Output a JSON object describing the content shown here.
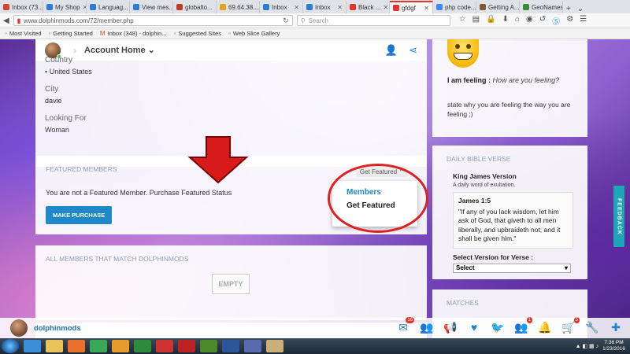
{
  "browser": {
    "tabs": [
      {
        "label": "Inbox (73...",
        "color": "#d44638"
      },
      {
        "label": "My Shop",
        "color": "#2e7bd6"
      },
      {
        "label": "Languag...",
        "color": "#2e7bd6"
      },
      {
        "label": "View mes...",
        "color": "#2e7bd6"
      },
      {
        "label": "globalto...",
        "color": "#c0392b"
      },
      {
        "label": "69.64.38....",
        "color": "#e8a317"
      },
      {
        "label": "Inbox",
        "color": "#2e7bd6"
      },
      {
        "label": "Inbox",
        "color": "#2e7bd6"
      },
      {
        "label": "Black ...",
        "color": "#e3352b"
      },
      {
        "label": "gfdgf",
        "color": "#e3352b"
      },
      {
        "label": "php code...",
        "color": "#4285f4"
      },
      {
        "label": "Getting A...",
        "color": "#7a5a3a"
      },
      {
        "label": "GeoNames",
        "color": "#3a8a3a"
      }
    ],
    "url": "www.dolphinmods.com/72/member.php",
    "search_placeholder": "Search",
    "bookmarks": [
      "Most Visited",
      "Getting Started",
      "Inbox (348) - dolphin...",
      "Suggested Sites",
      "Web Slice Gallery"
    ]
  },
  "header": {
    "title": "Account Home"
  },
  "profile": {
    "country_label": "Country",
    "country_value": "United States",
    "city_label": "City",
    "city_value": "davie",
    "looking_label": "Looking For",
    "looking_value": "Woman"
  },
  "featured": {
    "heading": "FEATURED MEMBERS",
    "toggle_label": "Get Featured",
    "message": "You are not a Featured Member. Purchase Featured Status",
    "button": "MAKE PURCHASE",
    "dropdown": [
      "Members",
      "Get Featured"
    ]
  },
  "all_members": {
    "heading": "ALL MEMBERS THAT MATCH DOLPHINMODS",
    "empty": "EMPTY"
  },
  "mood": {
    "feeling_label": "I am feeling :",
    "feeling_placeholder": "How are you feeling?",
    "state_text": "state why you are feeling the way you are feeling :)"
  },
  "bible": {
    "heading": "DAILY BIBLE VERSE",
    "version": "King James Version",
    "subtitle": "A daily word of exultation.",
    "reference": "James 1:5",
    "verse": "\"If any of you lack wisdom, let him ask of God, that giveth to all men liberally, and upbraideth not; and it shall be given him.\"",
    "select_label": "Select Version for Verse :",
    "select_value": "Select"
  },
  "matches": {
    "heading": "MATCHES"
  },
  "feedback_label": "FEEDBACK",
  "appbar": {
    "username": "dolphinmods",
    "mail_badge": "16",
    "notif_badge": "1",
    "cart_badge": "5"
  },
  "taskbar": {
    "time": "7:36 PM",
    "date": "1/23/2016"
  }
}
